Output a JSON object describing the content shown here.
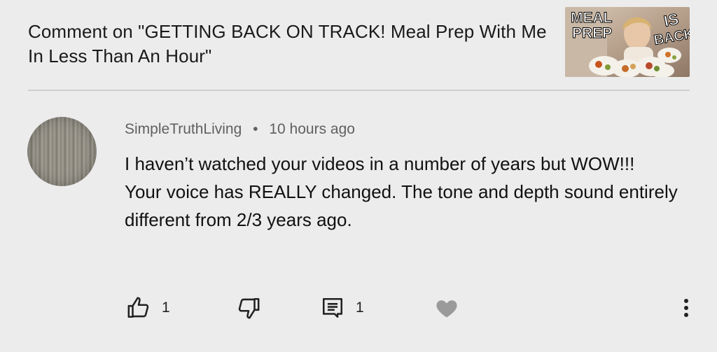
{
  "header": {
    "title": "Comment on \"GETTING BACK ON TRACK! Meal Prep With Me In Less Than An Hour\""
  },
  "thumbnail": {
    "text_left": "MEAL PREP",
    "text_right": "IS BACK!"
  },
  "comment": {
    "author": "SimpleTruthLiving",
    "separator": "•",
    "timestamp": "10 hours ago",
    "paragraphs": [
      "I haven’t watched your videos in a number of years but WOW!!!",
      "Your voice has REALLY changed. The tone and depth sound entirely different from 2/3 years ago."
    ]
  },
  "actions": {
    "like_count": "1",
    "reply_count": "1"
  },
  "icons": {
    "like": "thumb-up-icon",
    "dislike": "thumb-down-icon",
    "reply": "comment-icon",
    "heart": "heart-icon",
    "more": "more-vertical-icon"
  },
  "colors": {
    "background": "#ececec",
    "meta_text": "#606060",
    "icon": "#222222",
    "heart": "#9a9a9a",
    "divider": "#cfcfcf"
  }
}
